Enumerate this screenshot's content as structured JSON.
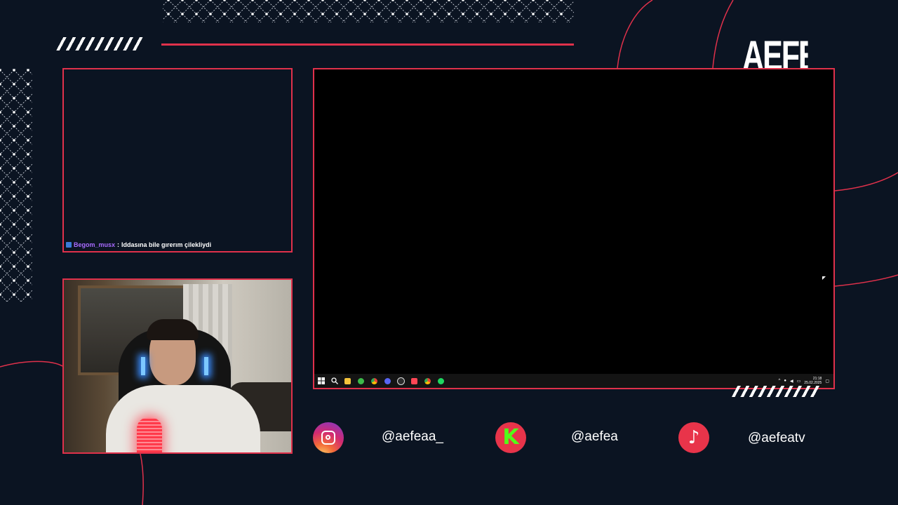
{
  "brand": {
    "name": "AEFEA"
  },
  "chat": {
    "username": "Begom_musx",
    "separator": " : ",
    "message": "Iddasına bile gırerım çilekliydi"
  },
  "screen": {
    "taskbar": {
      "icons": [
        "windows-start-icon",
        "search-icon",
        "file-explorer-icon",
        "xbox-icon",
        "chrome-icon",
        "discord-icon",
        "obs-icon",
        "valorant-icon",
        "chrome-icon",
        "spotify-icon"
      ],
      "time": "21:18",
      "date": "25.02.2025"
    }
  },
  "socials": {
    "instagram": {
      "handle": "@aefeaa_"
    },
    "kick": {
      "handle": "@aefea"
    },
    "tiktok": {
      "handle": "@aefeatv"
    }
  },
  "colors": {
    "background": "#0b1422",
    "accent": "#e0314b",
    "kick_green": "#53fc18"
  }
}
